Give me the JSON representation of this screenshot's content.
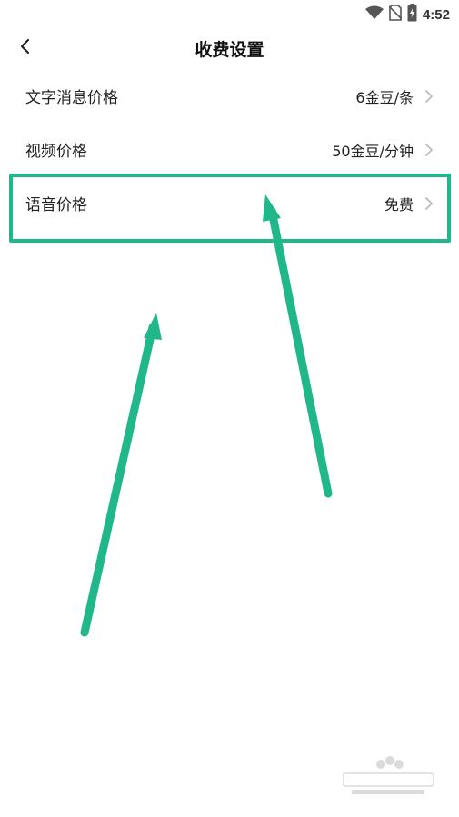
{
  "status_bar": {
    "time": "4:52"
  },
  "header": {
    "title": "收费设置"
  },
  "settings": [
    {
      "label": "文字消息价格",
      "value": "6金豆/条"
    },
    {
      "label": "视频价格",
      "value": "50金豆/分钟"
    },
    {
      "label": "语音价格",
      "value": "免费"
    }
  ],
  "colors": {
    "annotation": "#20b88a",
    "chevron": "#bbbbbb"
  },
  "icons": {
    "back": "chevron-left-icon",
    "row_arrow": "chevron-right-icon",
    "wifi": "wifi-icon",
    "no_sim": "no-sim-icon",
    "battery": "battery-icon"
  }
}
